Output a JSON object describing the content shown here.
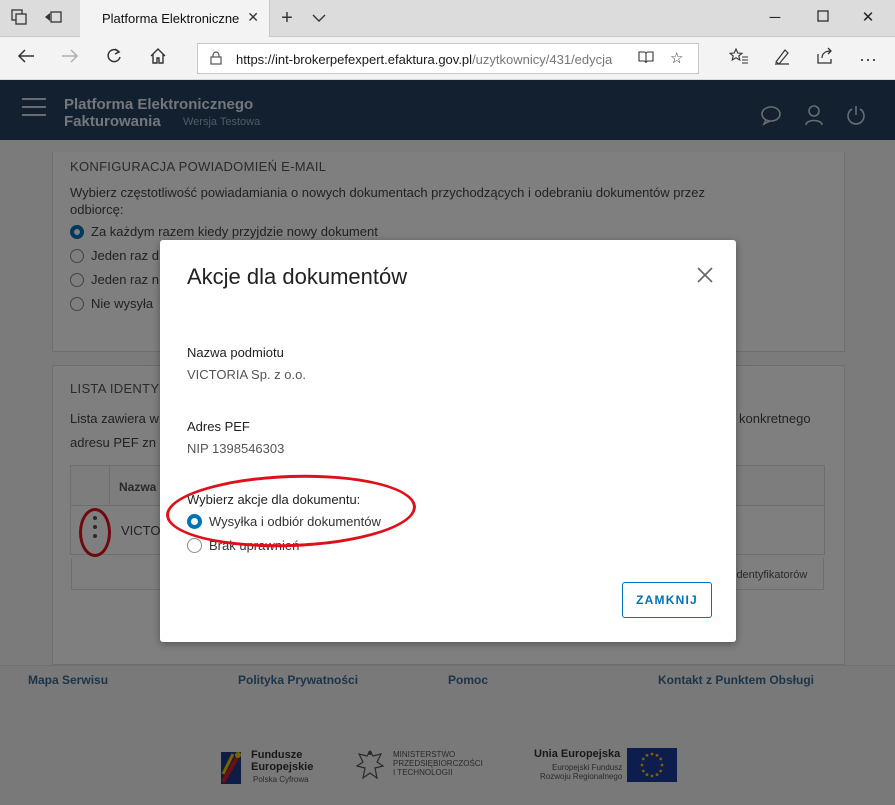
{
  "browser": {
    "tab_title": "Platforma Elektroniczne",
    "url_host": "https://int-brokerpefexpert.efaktura.gov.pl",
    "url_path": "/uzytkownicy/431/edycja"
  },
  "app": {
    "title_line1": "Platforma Elektronicznego",
    "title_line2": "Fakturowania",
    "subtitle": "Wersja Testowa"
  },
  "email_config": {
    "title": "KONFIGURACJA POWIADOMIEŃ E-MAIL",
    "description_line1": "Wybierz częstotliwość powiadamiania o nowych dokumentach przychodzących i odebraniu dokumentów przez",
    "description_line2": "odbiorcę:",
    "options": [
      "Za każdym razem kiedy przyjdzie nowy dokument",
      "Jeden raz d",
      "Jeden raz n",
      "Nie wysyła"
    ]
  },
  "identifiers": {
    "title": "LISTA IDENTY",
    "description_line1_start": "Lista zawiera w",
    "description_line1_end": "konkretnego",
    "description_line2": "adresu PEF zn",
    "column_name": "Nazwa",
    "row_value": "VICTO",
    "footer_text": "identyfikatorów"
  },
  "footer": {
    "links": [
      "Mapa Serwisu",
      "Polityka Prywatności",
      "Pomoc",
      "Kontakt z Punktem Obsługi"
    ],
    "logo1_title_1": "Fundusze",
    "logo1_title_2": "Europejskie",
    "logo1_sub": "Polska Cyfrowa",
    "logo2_line1": "MINISTERSTWO",
    "logo2_line2": "PRZEDSIĘBIORCZOŚCI",
    "logo2_line3": "I TECHNOLOGII",
    "logo3_title": "Unia Europejska",
    "logo3_sub1": "Europejski Fundusz",
    "logo3_sub2": "Rozwoju Regionalnego"
  },
  "modal": {
    "title": "Akcje dla dokumentów",
    "entity_label": "Nazwa podmiotu",
    "entity_value": "VICTORIA Sp. z o.o.",
    "pef_label": "Adres PEF",
    "pef_value": "NIP 1398546303",
    "actions_label": "Wybierz akcje dla dokumentu:",
    "options": [
      "Wysyłka i odbiór dokumentów",
      "Brak uprawnień"
    ],
    "selected_option": "Wysyłka i odbiór dokumentów",
    "close_button": "ZAMKNIJ"
  },
  "colors": {
    "header_bg": "#24415f",
    "accent": "#0072b7",
    "annotation": "#e0101a"
  }
}
